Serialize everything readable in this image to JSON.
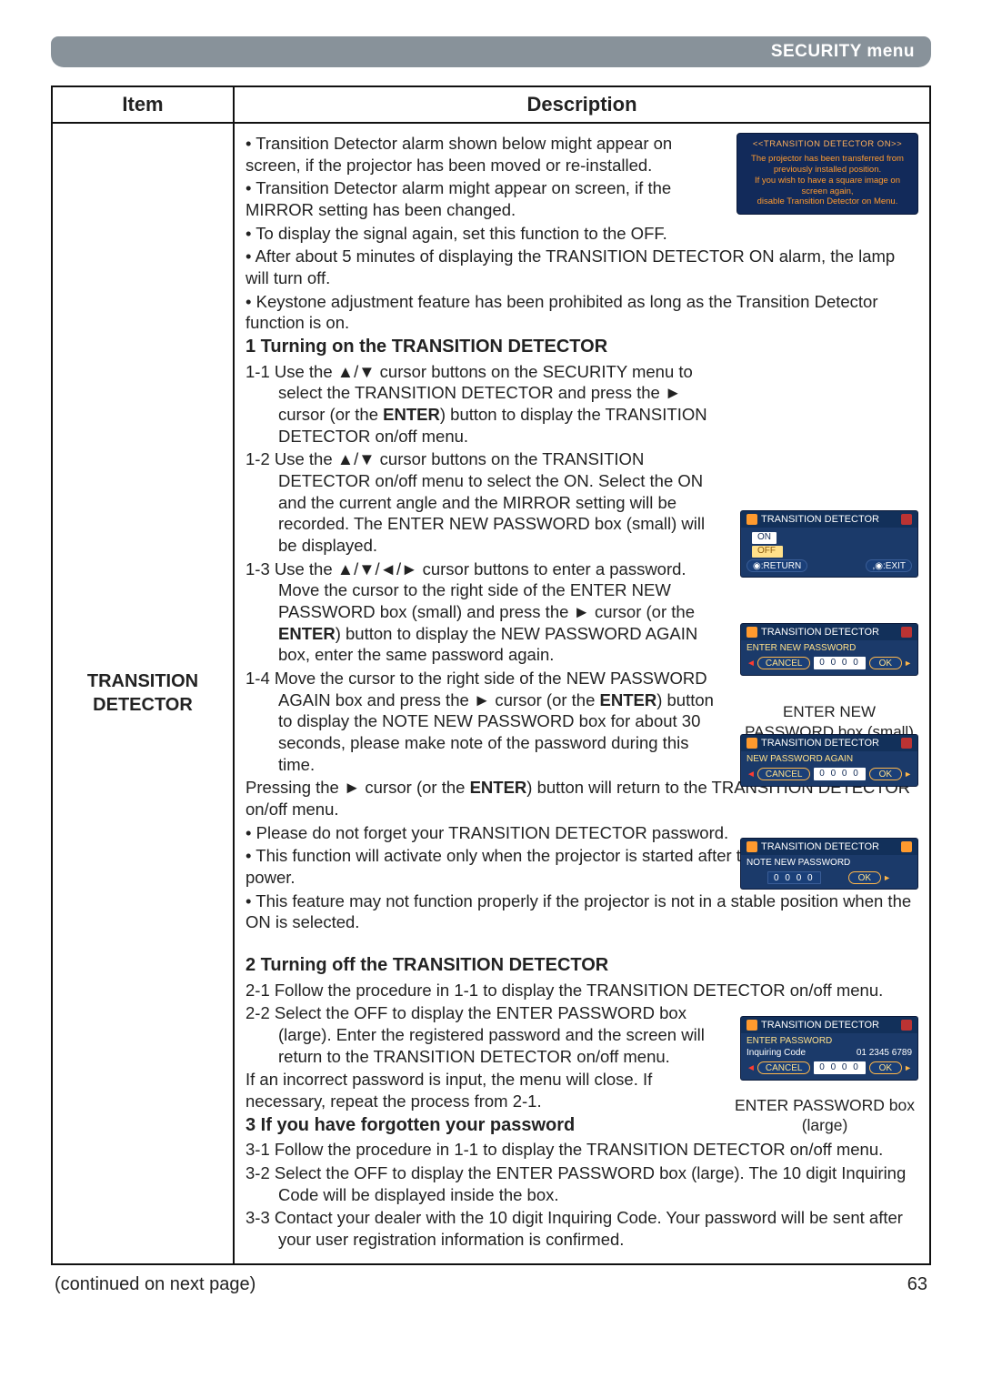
{
  "header": {
    "menu_title": "SECURITY menu"
  },
  "table": {
    "head_item": "Item",
    "head_desc": "Description",
    "item_label": "TRANSITION DETECTOR"
  },
  "intro": {
    "b1": "• Transition Detector alarm shown below might appear on screen, if the projector has been moved or re-installed.",
    "b2": "• Transition Detector alarm might appear on screen, if the MIRROR setting has been changed.",
    "b3": "• To display the signal again, set this function to the OFF.",
    "b4": "• After about 5 minutes of displaying the TRANSITION DETECTOR ON alarm, the lamp will turn off.",
    "b5": "• Keystone adjustment feature has been prohibited as long as the Transition Detector function is on."
  },
  "alarm": {
    "title": "<<TRANSITION DETECTOR ON>>",
    "l1": "The projector has been transferred from previously installed position.",
    "l2": "If you wish to have a square image on screen again,",
    "l3": "disable Transition Detector on Menu."
  },
  "sec1": {
    "title": "1 Turning on the TRANSITION DETECTOR",
    "s1a": "1-1 Use the ▲/▼ cursor buttons on the SECURITY menu to select the TRANSITION DETECTOR and press the ► cursor (or the ",
    "s1b": "ENTER",
    "s1c": ") button to display the TRANSITION DETECTOR on/off menu.",
    "s2": "1-2 Use the ▲/▼ cursor buttons on the TRANSITION DETECTOR on/off menu to select the ON. Select the ON and the current angle and the MIRROR setting will be recorded. The ENTER NEW PASSWORD box (small) will be displayed.",
    "s3a": "1-3 Use the ▲/▼/◄/► cursor buttons to enter a password. Move the cursor to the right side of the ENTER NEW PASSWORD box (small) and press the ► cursor (or the ",
    "s3b": "ENTER",
    "s3c": ") button to display the NEW PASSWORD AGAIN box, enter the same password again.",
    "s4a": "1-4 Move the cursor to the right side of the NEW PASSWORD AGAIN box and press the ► cursor (or the ",
    "s4b": "ENTER",
    "s4c": ") button to display the NOTE NEW PASSWORD box for about 30 seconds, please make note of the password during this time.",
    "tail_a": "Pressing the ► cursor (or the ",
    "tail_b": "ENTER",
    "tail_c": ") button will return to the TRANSITION DETECTOR on/off menu.",
    "n1": "• Please do not forget your TRANSITION DETECTOR password.",
    "n2": "• This function will activate only when the projector is started after turning off the AC power.",
    "n3": "• This feature may not function properly if the projector is not in a stable position when the ON is selected.",
    "cap_small": "ENTER NEW PASSWORD box (small)"
  },
  "osd": {
    "title": "TRANSITION DETECTOR",
    "on": "ON",
    "off": "OFF",
    "return": "◉:RETURN",
    "exit": ",◉:EXIT",
    "enter_new": "ENTER NEW PASSWORD",
    "again": "NEW PASSWORD AGAIN",
    "note": "NOTE NEW PASSWORD",
    "enter_pw": "ENTER PASSWORD",
    "inq_label": "Inquiring Code",
    "inq_code": "01 2345 6789",
    "cancel": "CANCEL",
    "zeros": "0 0 0 0",
    "ok": "OK"
  },
  "sec2": {
    "title": "2 Turning off the TRANSITION DETECTOR",
    "s1": "2-1 Follow the procedure in 1-1 to display the TRANSITION DETECTOR on/off menu.",
    "s2": "2-2 Select the OFF to display the ENTER PASSWORD box (large). Enter the registered password and the screen will return to the TRANSITION DETECTOR on/off menu.",
    "tail": "If an incorrect password is input, the menu will close. If necessary, repeat the process from 2-1.",
    "cap_large": "ENTER PASSWORD box (large)"
  },
  "sec3": {
    "title": "3 If you have forgotten your password",
    "s1": "3-1 Follow the procedure in 1-1 to display the TRANSITION DETECTOR on/off menu.",
    "s2": "3-2 Select the OFF to display the ENTER PASSWORD box (large). The 10 digit Inquiring Code will be displayed inside the box.",
    "s3": "3-3 Contact your dealer with the 10 digit Inquiring Code. Your password will be sent after your user registration information is confirmed."
  },
  "footer": {
    "cont": "(continued on next page)",
    "page": "63"
  }
}
